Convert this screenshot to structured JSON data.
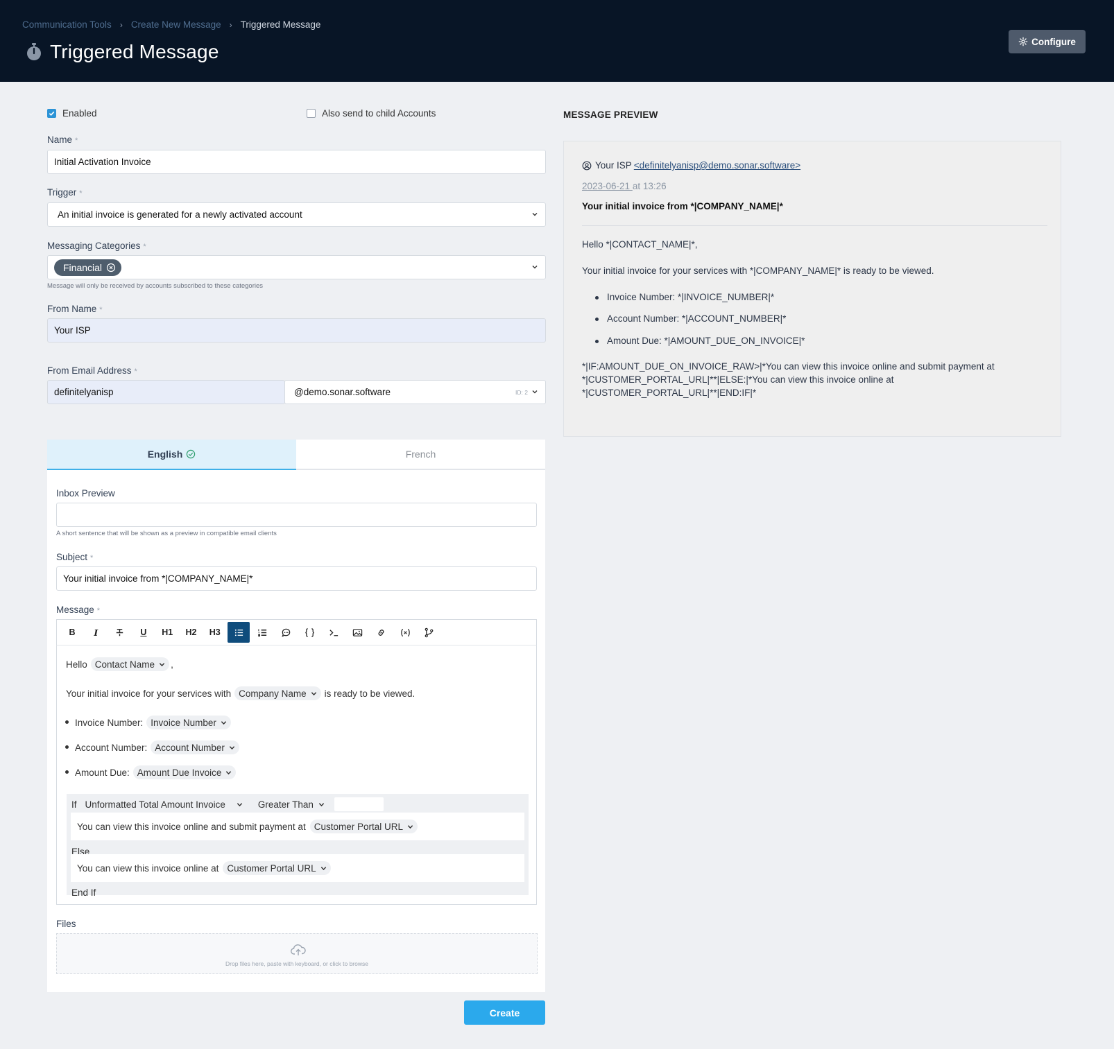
{
  "header": {
    "breadcrumbs": [
      "Communication Tools",
      "Create New Message",
      "Triggered Message"
    ],
    "title": "Triggered Message",
    "configure_label": "Configure"
  },
  "form": {
    "enabled_label": "Enabled",
    "enabled": true,
    "child_accounts_label": "Also send to child Accounts",
    "child_accounts": false,
    "name_label": "Name",
    "name_value": "Initial Activation Invoice",
    "trigger_label": "Trigger",
    "trigger_value": "An initial invoice is generated for a newly activated account",
    "categories_label": "Messaging Categories",
    "categories": [
      "Financial"
    ],
    "categories_hint": "Message will only be received by accounts subscribed to these categories",
    "from_name_label": "From Name",
    "from_name_value": "Your ISP",
    "from_email_label": "From Email Address",
    "from_email_local": "definitelyanisp",
    "from_email_domain": "@demo.sonar.software",
    "from_email_id": "ID: 2"
  },
  "tabs": [
    {
      "label": "English",
      "active": true
    },
    {
      "label": "French",
      "active": false
    }
  ],
  "content": {
    "inbox_preview_label": "Inbox Preview",
    "inbox_preview_value": "",
    "inbox_preview_hint": "A short sentence that will be shown as a preview in compatible email clients",
    "subject_label": "Subject",
    "subject_value": "Your initial invoice from *|COMPANY_NAME|*",
    "message_label": "Message",
    "toolbar": [
      "B",
      "I",
      "strikethrough-icon",
      "U",
      "H1",
      "H2",
      "H3",
      "bullet-list-icon",
      "numbered-list-icon",
      "comment-icon",
      "code-braces-icon",
      "terminal-icon",
      "image-icon",
      "link-icon",
      "variable-icon",
      "branch-icon"
    ],
    "editor": {
      "hello": "Hello",
      "contact_tag": "Contact Name",
      "comma": ",",
      "line2_pre": "Your initial invoice for your services with",
      "company_tag": "Company Name",
      "line2_post": "is ready to be viewed.",
      "items": [
        {
          "label": "Invoice Number:",
          "tag": "Invoice Number"
        },
        {
          "label": "Account Number:",
          "tag": "Account Number"
        },
        {
          "label": "Amount Due:",
          "tag": "Amount Due Invoice"
        }
      ],
      "if_label": "If",
      "if_field": "Unformatted Total Amount Invoice",
      "if_operator": "Greater Than",
      "if_value": "",
      "then_text": "You can view this invoice online and submit payment at",
      "then_tag": "Customer Portal URL",
      "else_label": "Else",
      "else_text": "You can view this invoice online at",
      "else_tag": "Customer Portal URL",
      "endif_label": "End If"
    },
    "files_label": "Files",
    "files_hint": "Drop files here, paste with keyboard, or click to browse",
    "create_label": "Create"
  },
  "preview": {
    "title": "MESSAGE PREVIEW",
    "from_name": "Your ISP",
    "from_email": "<definitelyanisp@demo.sonar.software>",
    "date": "2023-06-21 ",
    "time": "at 13:26",
    "subject": "Your initial invoice from *|COMPANY_NAME|*",
    "greeting": "Hello *|CONTACT_NAME|*,",
    "intro": "Your initial invoice for your services with *|COMPANY_NAME|* is ready to be viewed.",
    "items": [
      "Invoice Number: *|INVOICE_NUMBER|*",
      "Account Number: *|ACCOUNT_NUMBER|*",
      "Amount Due: *|AMOUNT_DUE_ON_INVOICE|*"
    ],
    "conditional_lines": [
      "*|IF:AMOUNT_DUE_ON_INVOICE_RAW>|*You can view this invoice online and submit payment at",
      "*|CUSTOMER_PORTAL_URL|**|ELSE:|*You can view this invoice online at",
      "*|CUSTOMER_PORTAL_URL|**|END:IF|*"
    ]
  },
  "colors": {
    "header_bg": "#081526",
    "accent": "#2ba9ec",
    "pill_bg": "#4e5d6c"
  }
}
